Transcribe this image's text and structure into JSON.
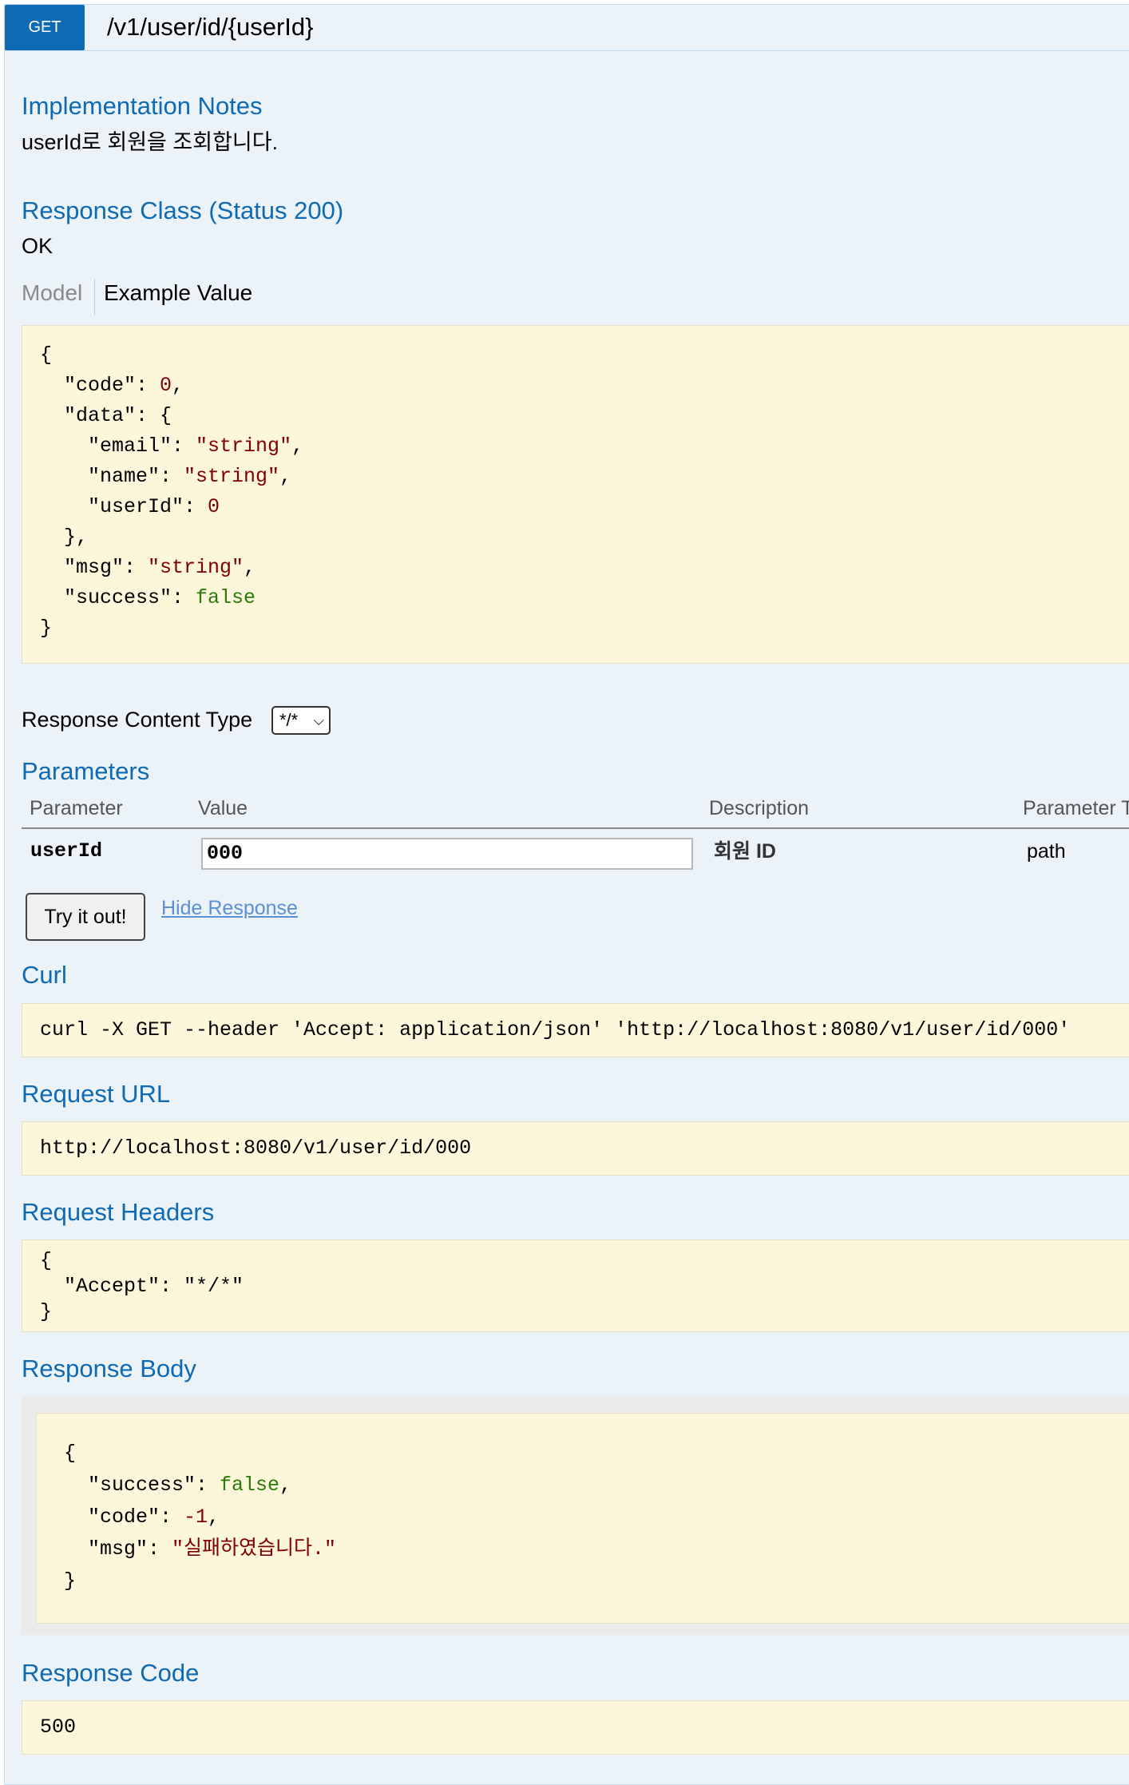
{
  "operation": {
    "method": "GET",
    "path": "/v1/user/id/{userId}"
  },
  "implementation": {
    "heading": "Implementation Notes",
    "text": "userId로 회원을 조회합니다."
  },
  "response_class": {
    "heading": "Response Class (Status 200)",
    "text": "OK",
    "tabs": [
      "Model",
      "Example Value"
    ],
    "example_lines": [
      "{",
      "  \"code\": 0,",
      "  \"data\": {",
      "    \"email\": \"string\",",
      "    \"name\": \"string\",",
      "    \"userId\": 0",
      "  },",
      "  \"msg\": \"string\",",
      "  \"success\": false",
      "}"
    ]
  },
  "content_type": {
    "label": "Response Content Type",
    "selected": "*/*"
  },
  "parameters": {
    "heading": "Parameters",
    "columns": [
      "Parameter",
      "Value",
      "Description",
      "Parameter Type"
    ],
    "rows": [
      {
        "name": "userId",
        "value": "000",
        "description": "회원 ID",
        "type": "path"
      }
    ]
  },
  "actions": {
    "try_label": "Try it out!",
    "hide_label": "Hide Response"
  },
  "curl": {
    "heading": "Curl",
    "command": "curl -X GET --header 'Accept: application/json' 'http://localhost:8080/v1/user/id/000'"
  },
  "request_url": {
    "heading": "Request URL",
    "value": "http://localhost:8080/v1/user/id/000"
  },
  "request_headers": {
    "heading": "Request Headers",
    "lines": [
      "{",
      "  \"Accept\": \"*/*\"",
      "}"
    ]
  },
  "response_body": {
    "heading": "Response Body",
    "lines": [
      "{",
      "  \"success\": false,",
      "  \"code\": -1,",
      "  \"msg\": \"실패하였습니다.\"",
      "}"
    ]
  },
  "response_code": {
    "heading": "Response Code",
    "value": "500"
  },
  "colors": {
    "method_bg": "#0f6ab4",
    "panel_bg": "#ebf3f9",
    "code_bg": "#fcf6db",
    "heading": "#0f6ab4",
    "string_value": "#800000",
    "boolean_value": "#2a7a09"
  }
}
